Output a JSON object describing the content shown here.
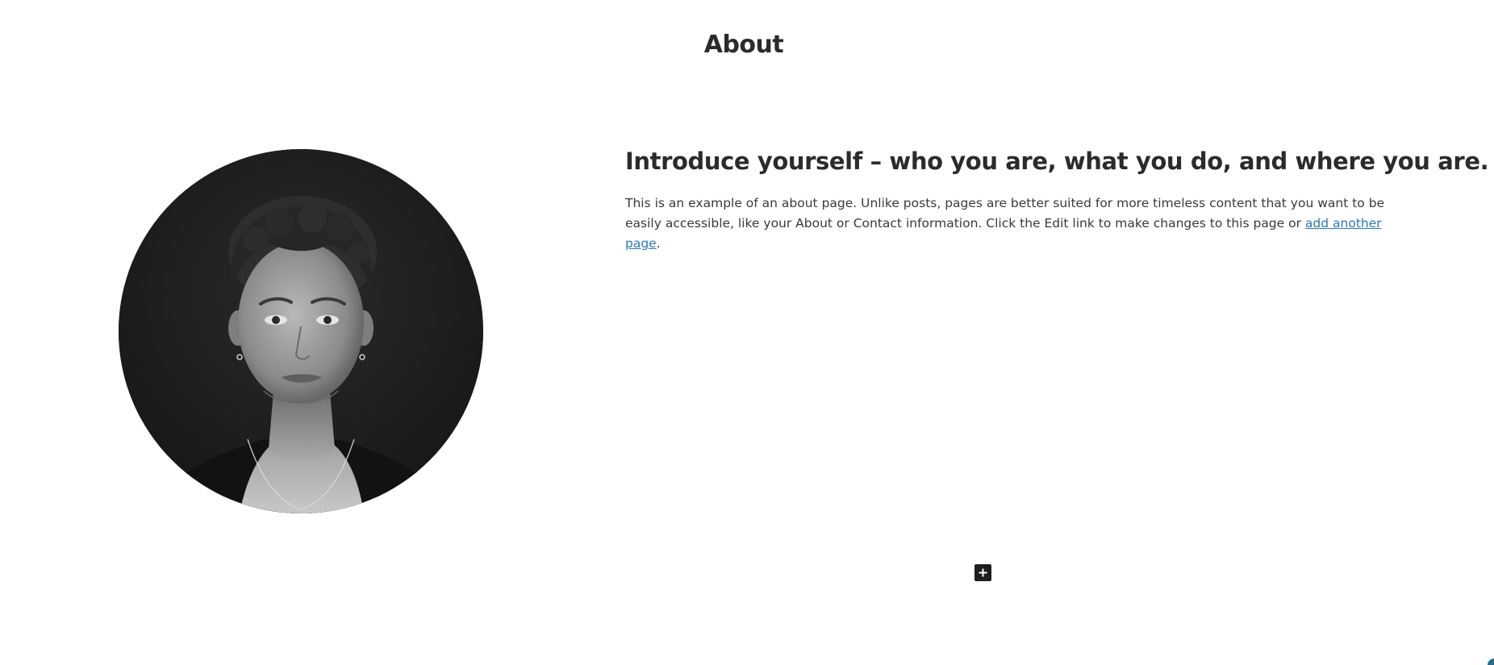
{
  "page": {
    "title": "About"
  },
  "portrait": {
    "alt": "portrait photo",
    "style": "black-and-white"
  },
  "intro": {
    "heading": "Introduce yourself – who you are, what you do, and where you are.",
    "paragraph_before_link": "This is an example of an about page. Unlike posts, pages are better suited for more timeless content that you want to be easily accessible, like your About or Contact information. Click the Edit link to make changes to this page or ",
    "link_text": "add another page",
    "paragraph_after_link": "."
  },
  "controls": {
    "add_block_icon": "plus-icon"
  },
  "colors": {
    "text": "#2b2b2b",
    "link": "#2a7ab8",
    "add_block_bg": "#1e1e1e"
  }
}
